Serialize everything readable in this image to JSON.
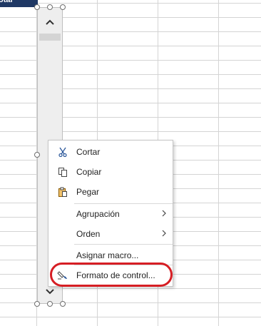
{
  "header_cell": {
    "text": "otal",
    "bg": "#1f3864"
  },
  "scrollbar": {
    "up_icon": "chevron-up-icon",
    "down_icon": "chevron-down-icon"
  },
  "context_menu": {
    "items": [
      {
        "label": "Cortar",
        "icon": "scissors-icon"
      },
      {
        "label": "Copiar",
        "icon": "copy-icon"
      },
      {
        "label": "Pegar",
        "icon": "paste-icon"
      },
      {
        "label": "Agrupación",
        "icon": "",
        "submenu": true
      },
      {
        "label": "Orden",
        "icon": "",
        "submenu": true
      },
      {
        "label": "Asignar macro...",
        "icon": ""
      },
      {
        "label": "Formato de control...",
        "icon": "format-control-icon"
      }
    ],
    "submenu_arrow": "›"
  },
  "colors": {
    "highlight": "#d61e24",
    "grid": "#d4d4d4"
  }
}
